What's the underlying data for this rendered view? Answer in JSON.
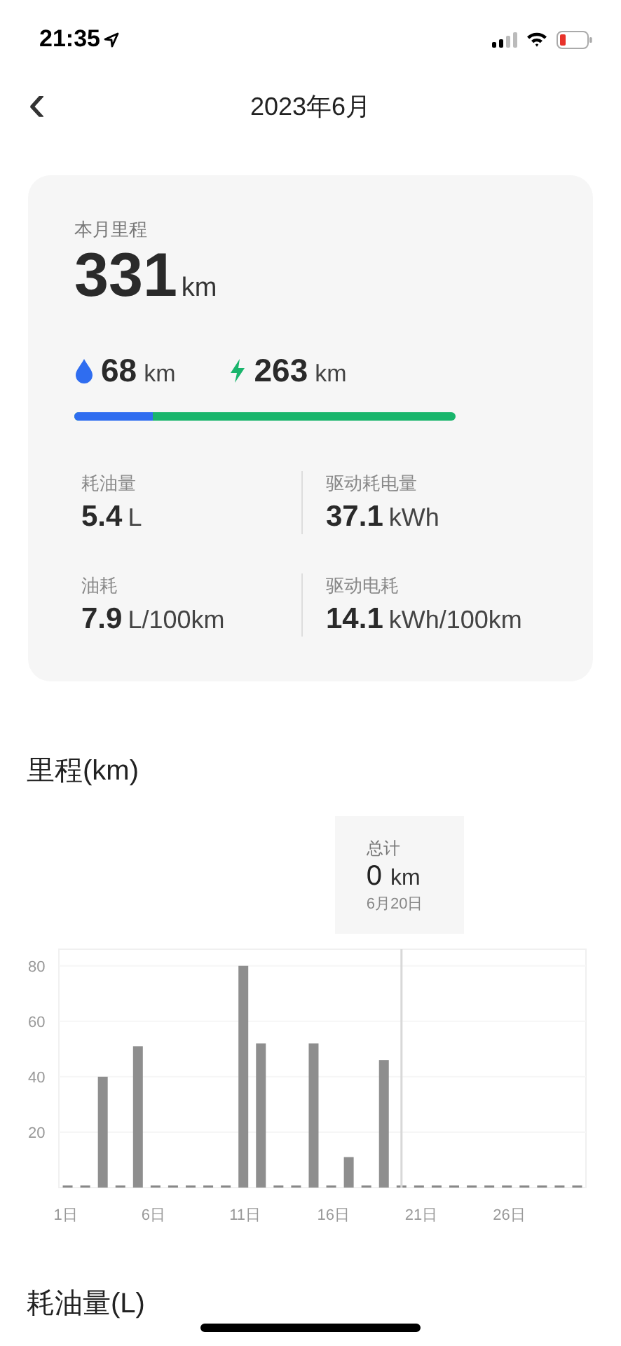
{
  "status_bar": {
    "time": "21:35"
  },
  "nav": {
    "back": "‹",
    "title": "2023年6月"
  },
  "summary": {
    "label": "本月里程",
    "value": "331",
    "unit": "km",
    "fuel": {
      "value": "68",
      "unit": "km"
    },
    "electric": {
      "value": "263",
      "unit": "km"
    },
    "split": {
      "level": 0.205
    },
    "stats": [
      {
        "label": "耗油量",
        "value": "5.4",
        "unit": "L"
      },
      {
        "label": "驱动耗电量",
        "value": "37.1",
        "unit": "kWh"
      },
      {
        "label": "油耗",
        "value": "7.9",
        "unit": "L/100km"
      },
      {
        "label": "驱动电耗",
        "value": "14.1",
        "unit": "kWh/100km"
      }
    ]
  },
  "mileage_section": {
    "title": "里程(km)",
    "tooltip": {
      "label": "总计",
      "value": "0",
      "unit": "km",
      "date": "6月20日"
    },
    "chart_data": {
      "type": "bar",
      "x": [
        1,
        2,
        3,
        4,
        5,
        6,
        7,
        8,
        9,
        10,
        11,
        12,
        13,
        14,
        15,
        16,
        17,
        18,
        19,
        20,
        21,
        22,
        23,
        24,
        25,
        26,
        27,
        28,
        29,
        30
      ],
      "values": [
        0,
        0,
        40,
        0,
        51,
        0,
        0,
        0,
        0,
        0,
        80,
        52,
        0,
        0,
        52,
        0,
        11,
        0,
        46,
        0,
        0,
        0,
        0,
        0,
        0,
        0,
        0,
        0,
        0,
        0
      ],
      "xlim": [
        0.5,
        30.5
      ],
      "ylim": [
        0,
        86
      ],
      "grid": true,
      "yticks": [
        20,
        40,
        60,
        80
      ],
      "xticks": [
        {
          "value": 1,
          "label": "1日"
        },
        {
          "value": 6,
          "label": "6日"
        },
        {
          "value": 11,
          "label": "11日"
        },
        {
          "value": 16,
          "label": "16日"
        },
        {
          "value": 21,
          "label": "21日"
        },
        {
          "value": 26,
          "label": "26日"
        }
      ],
      "ref_lines": [
        {
          "axis": "x",
          "value": 20
        }
      ]
    }
  },
  "next_section": {
    "title": "耗油量(L)"
  }
}
